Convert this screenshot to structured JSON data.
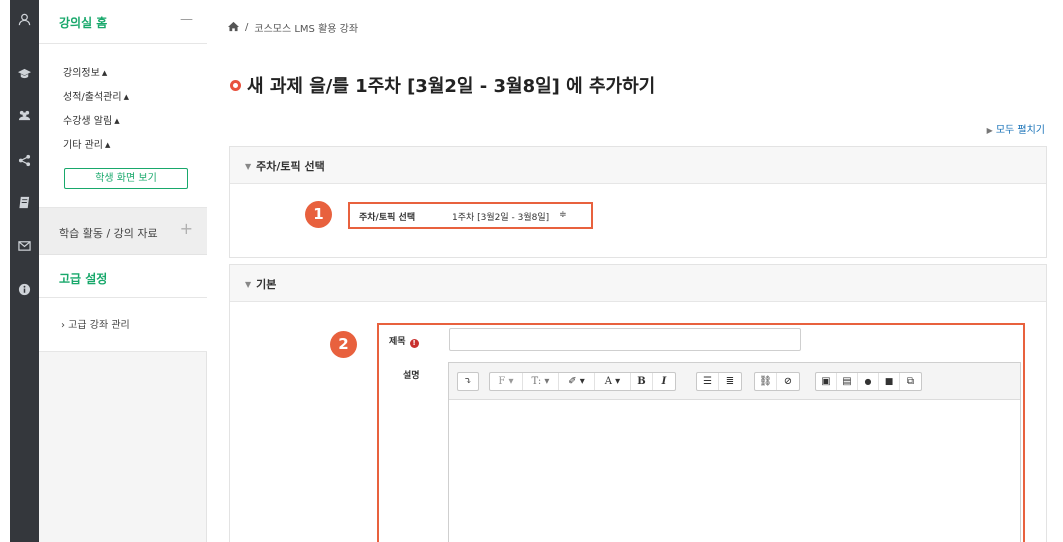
{
  "rail": {
    "icons": [
      "user-icon",
      "graduation-cap-icon",
      "users-icon",
      "share-icon",
      "book-icon",
      "envelope-icon",
      "info-icon"
    ]
  },
  "sidebar": {
    "home_label": "강의실 홈",
    "home_toggle": "—",
    "menu_items": [
      {
        "label": "강의정보",
        "caret": "▲"
      },
      {
        "label": "성적/출석관리",
        "caret": "▲"
      },
      {
        "label": "수강생 알림",
        "caret": "▲"
      },
      {
        "label": "기타 관리",
        "caret": "▲"
      }
    ],
    "student_view_button": "학생 화면 보기",
    "activity_label": "학습 활동 / 강의 자료",
    "activity_toggle": "+",
    "advanced_label": "고급 설정",
    "advanced_sub": "› 고급 강좌 관리"
  },
  "breadcrumb": {
    "separator": "/",
    "course": "코스모스 LMS 활용 강좌"
  },
  "page": {
    "title": "새 과제 을/를 1주차 [3월2일 - 3월8일] 에 추가하기",
    "expand_all": "모두 펼치기",
    "expand_caret": "▶"
  },
  "section_week": {
    "caret": "▼",
    "heading": "주차/토픽 선택",
    "marker": "1",
    "field_label": "주차/토픽 선택",
    "selected": "1주차 [3월2일 - 3월8일]",
    "select_arrow": "≑"
  },
  "section_basic": {
    "caret": "▼",
    "heading": "기본",
    "marker": "2",
    "title_label": "제목",
    "required_mark": "!",
    "desc_label": "설명"
  },
  "toolbar": {
    "groups": [
      [
        {
          "glyph": "⤵",
          "icon": "expand-toolbar-icon"
        }
      ],
      [
        {
          "glyph": "F ▾",
          "icon": "font-family-icon"
        },
        {
          "glyph": "T: ▾",
          "icon": "font-size-icon"
        },
        {
          "glyph": "✐ ▾",
          "icon": "brush-icon"
        },
        {
          "glyph": "A ▾",
          "icon": "font-color-icon"
        },
        {
          "glyph": "B",
          "icon": "bold-icon"
        },
        {
          "glyph": "I",
          "icon": "italic-icon"
        }
      ],
      [
        {
          "glyph": "☰",
          "icon": "unordered-list-icon"
        },
        {
          "glyph": "≣",
          "icon": "ordered-list-icon"
        }
      ],
      [
        {
          "glyph": "⛓",
          "icon": "link-icon"
        },
        {
          "glyph": "⊘",
          "icon": "unlink-icon"
        }
      ],
      [
        {
          "glyph": "▣",
          "icon": "image-icon"
        },
        {
          "glyph": "▤",
          "icon": "media-icon"
        },
        {
          "glyph": "●",
          "icon": "microphone-icon"
        },
        {
          "glyph": "■",
          "icon": "video-icon"
        },
        {
          "glyph": "⧉",
          "icon": "copy-icon"
        }
      ]
    ]
  },
  "colors": {
    "accent_green": "#18a86b",
    "highlight_orange": "#e8613e",
    "rail_dark": "#34373c",
    "link_blue": "#1a73b8"
  }
}
